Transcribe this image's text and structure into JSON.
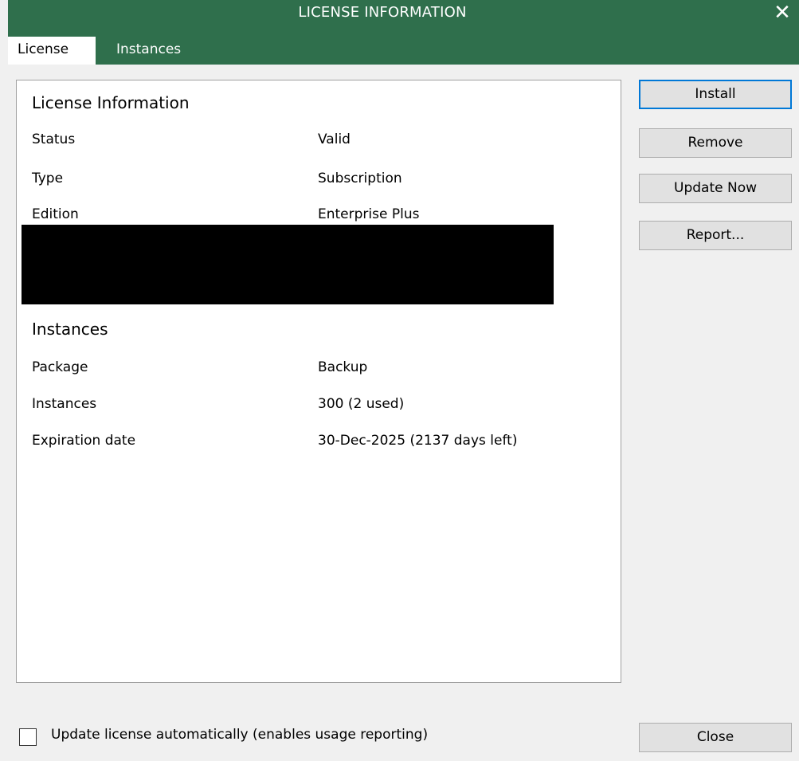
{
  "window": {
    "title": "LICENSE INFORMATION",
    "close_icon": "close-icon",
    "accent_color": "#2f6f4c"
  },
  "tabs": [
    {
      "label": "License",
      "active": true
    },
    {
      "label": "Instances",
      "active": false
    }
  ],
  "license_section": {
    "title": "License Information",
    "rows": [
      {
        "label": "Status",
        "value": "Valid"
      },
      {
        "label": "Type",
        "value": "Subscription"
      },
      {
        "label": "Edition",
        "value": "Enterprise Plus"
      }
    ]
  },
  "instances_section": {
    "title": "Instances",
    "rows": [
      {
        "label": "Package",
        "value": "Backup"
      },
      {
        "label": "Instances",
        "value": "300 (2 used)"
      },
      {
        "label": "Expiration date",
        "value": "30-Dec-2025 (2137 days left)"
      }
    ]
  },
  "buttons": {
    "install": "Install",
    "remove": "Remove",
    "update_now": "Update Now",
    "report": "Report...",
    "close": "Close"
  },
  "auto_update": {
    "label": "Update license automatically (enables usage reporting)",
    "checked": false
  }
}
